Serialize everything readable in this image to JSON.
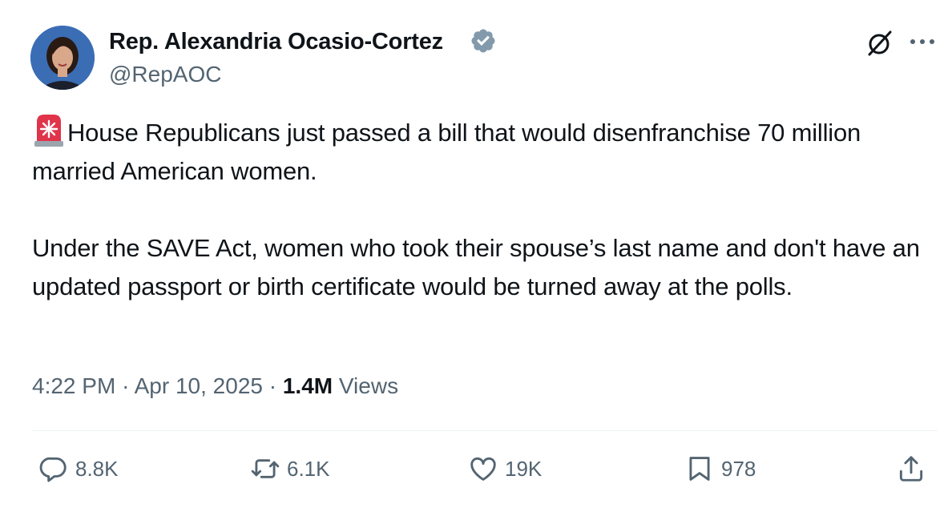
{
  "author": {
    "name": "Rep. Alexandria Ocasio-Cortez",
    "handle": "@RepAOC",
    "verified_icon": "verified-badge-icon"
  },
  "header_actions": {
    "grok_icon": "grok-icon",
    "more_icon": "more-icon"
  },
  "tweet": {
    "emoji": "police-siren-emoji",
    "paragraph_1": "House Republicans just passed a bill that would disenfranchise 70 million married American women.",
    "paragraph_2": "Under the SAVE Act, women who took their spouse’s last name and don't have an updated passport or birth certificate would be turned away at the polls."
  },
  "meta": {
    "time": "4:22 PM",
    "separator": "·",
    "date": "Apr 10, 2025",
    "views_count": "1.4M",
    "views_label": "Views"
  },
  "actions": {
    "replies": "8.8K",
    "reposts": "6.1K",
    "likes": "19K",
    "bookmarks": "978"
  },
  "colors": {
    "text_primary": "#0f1419",
    "text_secondary": "#536471",
    "verified": "#829aab",
    "divider": "#eff3f4"
  }
}
